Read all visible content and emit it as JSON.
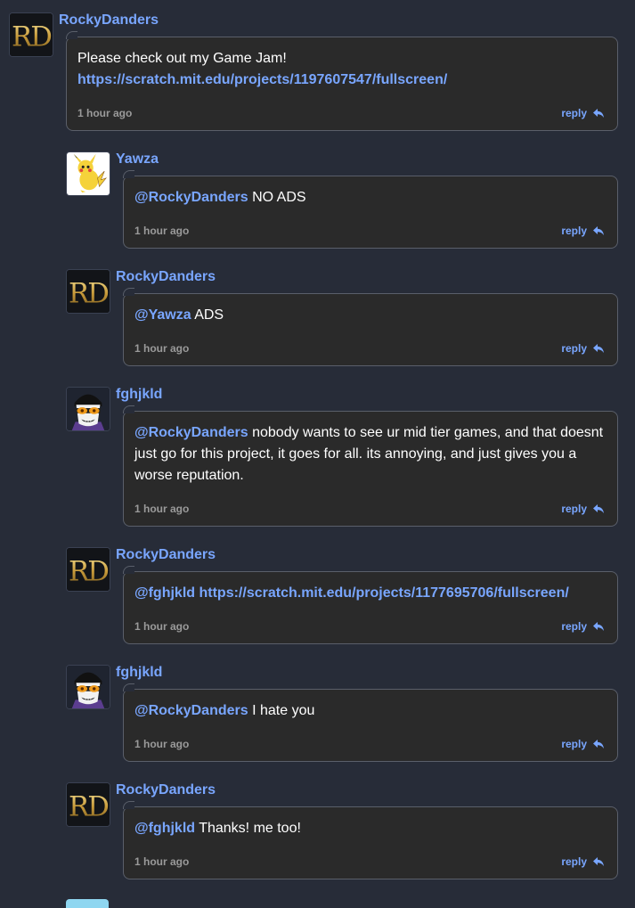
{
  "colors": {
    "background": "#272c38",
    "bubble": "#2a2a2a",
    "accent": "#79a6ff",
    "timestamp": "#9a9a9a"
  },
  "comments": [
    {
      "username": "RockyDanders",
      "avatar": "rd-logo-icon",
      "mention": "",
      "text": "Please check out my Game Jam!",
      "link": "https://scratch.mit.edu/projects/1197607547/fullscreen/",
      "time": "1 hour ago",
      "reply_label": "reply"
    },
    {
      "username": "Yawza",
      "avatar": "pikachu-icon",
      "mention": "@RockyDanders",
      "text": " NO ADS",
      "time": "1 hour ago",
      "reply_label": "reply"
    },
    {
      "username": "RockyDanders",
      "avatar": "rd-logo-icon",
      "mention": "@Yawza",
      "text": " ADS",
      "time": "1 hour ago",
      "reply_label": "reply"
    },
    {
      "username": "fghjkld",
      "avatar": "masked-face-icon",
      "mention": "@RockyDanders",
      "text": " nobody wants to see ur mid tier games, and that doesnt just go for this project, it goes for all. its annoying, and just gives you a worse reputation.",
      "time": "1 hour ago",
      "reply_label": "reply"
    },
    {
      "username": "RockyDanders",
      "avatar": "rd-logo-icon",
      "mention": "@fghjkld",
      "link": "https://scratch.mit.edu/projects/1177695706/fullscreen/",
      "time": "1 hour ago",
      "reply_label": "reply"
    },
    {
      "username": "fghjkld",
      "avatar": "masked-face-icon",
      "mention": "@RockyDanders",
      "text": " I hate you",
      "time": "1 hour ago",
      "reply_label": "reply"
    },
    {
      "username": "RockyDanders",
      "avatar": "rd-logo-icon",
      "mention": "@fghjkld",
      "text": " Thanks! me too!",
      "time": "1 hour ago",
      "reply_label": "reply"
    }
  ]
}
